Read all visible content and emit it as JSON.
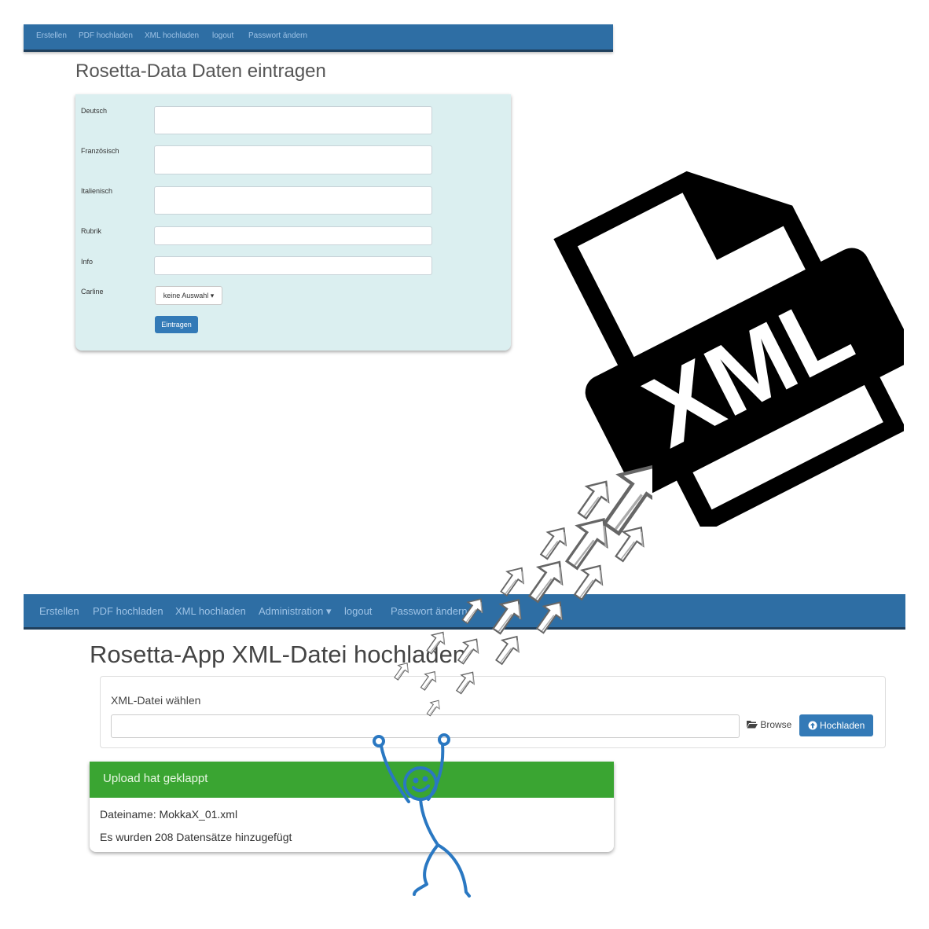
{
  "top_screen": {
    "nav": [
      "Erstellen",
      "PDF hochladen",
      "XML hochladen",
      "logout",
      "Passwort ändern"
    ],
    "title": "Rosetta-Data Daten eintragen",
    "form": {
      "labels": [
        "Deutsch",
        "Französisch",
        "Italienisch",
        "Rubrik",
        "Info",
        "Carline"
      ],
      "dropdown_value": "keine Auswahl",
      "submit_label": "Eintragen"
    }
  },
  "bottom_screen": {
    "nav": [
      "Erstellen",
      "PDF hochladen",
      "XML hochladen",
      "Administration",
      "logout",
      "Passwort ändern"
    ],
    "title": "Rosetta-App XML-Datei hochladen",
    "upload": {
      "label": "XML-Datei wählen",
      "browse_label": "Browse",
      "upload_label": "Hochladen"
    },
    "result": {
      "header": "Upload hat geklappt",
      "filename_line": "Dateiname: MokkaX_01.xml",
      "count_line": "Es wurden 208 Datensätze hinzugefügt"
    }
  },
  "overlay": {
    "file_icon_text": "XML",
    "icons": [
      "xml-file-icon",
      "upload-arrows",
      "stick-figure"
    ],
    "colors": {
      "nav": "#2e6ea4",
      "success": "#3aa532",
      "panel": "#dbeff0",
      "figure": "#2a78c2"
    }
  }
}
